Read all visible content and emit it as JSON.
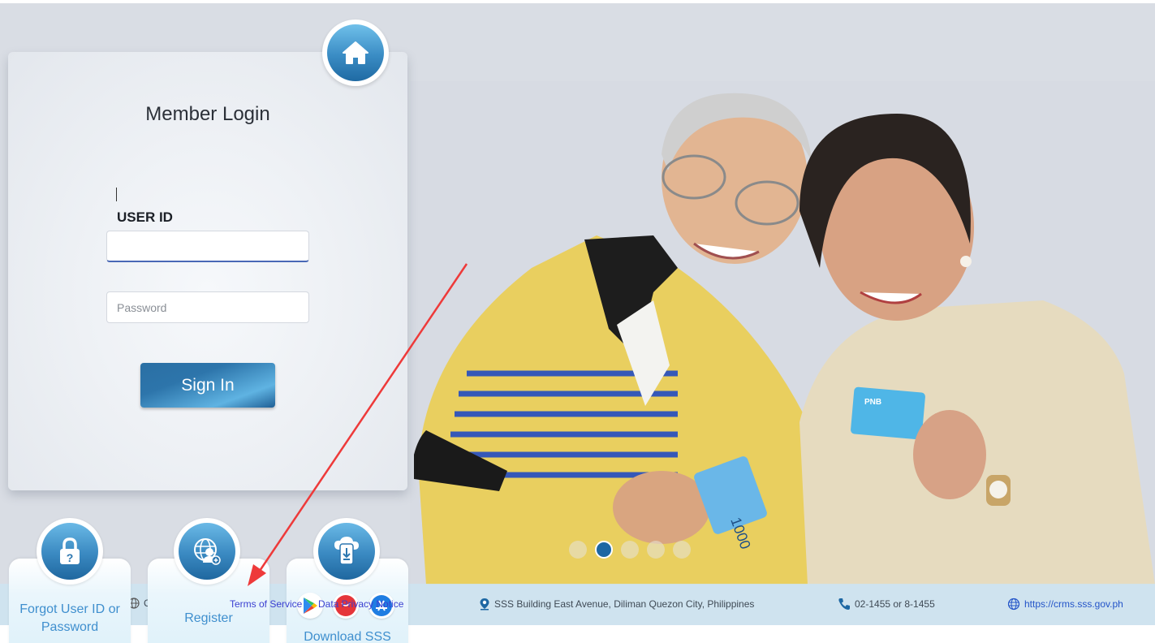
{
  "login": {
    "title": "Member Login",
    "userid_label": "USER ID",
    "userid_value": "",
    "password_placeholder": "Password",
    "signin_label": "Sign In"
  },
  "tiles": [
    {
      "label_line1": "Forgot User ID or",
      "label_line2": "Password",
      "icon": "lock-question-icon"
    },
    {
      "label_line1": "Register",
      "label_line2": "",
      "icon": "globe-user-add-icon"
    },
    {
      "label_line1": "Download SSS",
      "label_line2": "",
      "icon": "mobile-download-icon"
    }
  ],
  "legal_links": {
    "terms": "Terms of Service",
    "privacy": "Data Privacy Notice"
  },
  "footer": {
    "address": "SSS Building East Avenue, Diliman Quezon City, Philippines",
    "phone": "02-1455 or 8-1455",
    "website": "https://crms.sss.gov.ph",
    "globe_partial": "C"
  },
  "carousel": {
    "total_slides": 5,
    "active_index": 1
  },
  "hero": {
    "card_brand": "PNB",
    "banknote_value": "1000"
  },
  "colors": {
    "accent_blue": "#1d67a3",
    "link_blue": "#2354c8",
    "annotation_red": "#ee3a3a"
  }
}
